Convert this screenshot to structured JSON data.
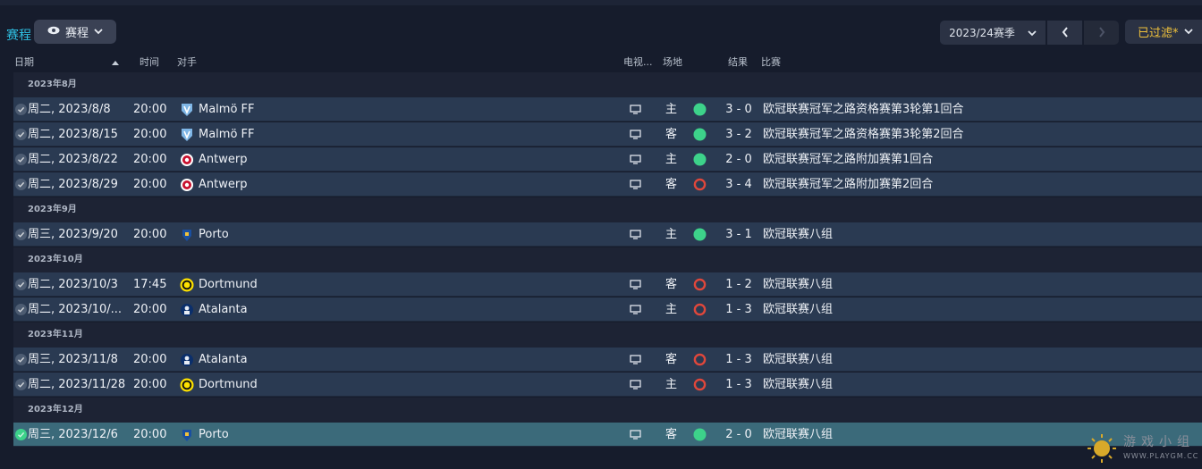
{
  "header": {
    "title": "赛程",
    "view_label": "赛程",
    "season_label": "2023/24赛季",
    "filter_label": "已过滤*"
  },
  "columns": {
    "date": "日期",
    "time": "时间",
    "opponent": "对手",
    "tv": "电视...",
    "venue": "场地",
    "result": "结果",
    "competition": "比赛"
  },
  "colors": {
    "accent": "#2fc0e3",
    "filter": "#f0c23b",
    "win": "#3dd28a",
    "loss": "#e0473b",
    "row": "#2a3a52",
    "selected_row": "#3b6a7a"
  },
  "months": [
    "2023年8月",
    "2023年9月",
    "2023年10月",
    "2023年11月",
    "2023年12月"
  ],
  "matches": [
    {
      "date": "周二, 2023/8/8",
      "time": "20:00",
      "opponent": "Malmö FF",
      "badge": "malmo-badge-icon",
      "venue": "主",
      "result": "win",
      "score": "3 - 0",
      "competition": "欧冠联赛冠军之路资格赛第3轮第1回合"
    },
    {
      "date": "周二, 2023/8/15",
      "time": "20:00",
      "opponent": "Malmö FF",
      "badge": "malmo-badge-icon",
      "venue": "客",
      "result": "win",
      "score": "3 - 2",
      "competition": "欧冠联赛冠军之路资格赛第3轮第2回合"
    },
    {
      "date": "周二, 2023/8/22",
      "time": "20:00",
      "opponent": "Antwerp",
      "badge": "antwerp-badge-icon",
      "venue": "主",
      "result": "win",
      "score": "2 - 0",
      "competition": "欧冠联赛冠军之路附加赛第1回合"
    },
    {
      "date": "周二, 2023/8/29",
      "time": "20:00",
      "opponent": "Antwerp",
      "badge": "antwerp-badge-icon",
      "venue": "客",
      "result": "loss",
      "score": "3 - 4",
      "competition": "欧冠联赛冠军之路附加赛第2回合"
    },
    {
      "date": "周三, 2023/9/20",
      "time": "20:00",
      "opponent": "Porto",
      "badge": "porto-badge-icon",
      "venue": "主",
      "result": "win",
      "score": "3 - 1",
      "competition": "欧冠联赛八组"
    },
    {
      "date": "周二, 2023/10/3",
      "time": "17:45",
      "opponent": "Dortmund",
      "badge": "dortmund-badge-icon",
      "venue": "客",
      "result": "loss",
      "score": "1 - 2",
      "competition": "欧冠联赛八组"
    },
    {
      "date": "周二, 2023/10/...",
      "time": "20:00",
      "opponent": "Atalanta",
      "badge": "atalanta-badge-icon",
      "venue": "主",
      "result": "loss",
      "score": "1 - 3",
      "competition": "欧冠联赛八组"
    },
    {
      "date": "周三, 2023/11/8",
      "time": "20:00",
      "opponent": "Atalanta",
      "badge": "atalanta-badge-icon",
      "venue": "客",
      "result": "loss",
      "score": "1 - 3",
      "competition": "欧冠联赛八组"
    },
    {
      "date": "周二, 2023/11/28",
      "time": "20:00",
      "opponent": "Dortmund",
      "badge": "dortmund-badge-icon",
      "venue": "主",
      "result": "loss",
      "score": "1 - 3",
      "competition": "欧冠联赛八组"
    },
    {
      "date": "周三, 2023/12/6",
      "time": "20:00",
      "opponent": "Porto",
      "badge": "porto-badge-icon",
      "venue": "客",
      "result": "win",
      "score": "2 - 0",
      "competition": "欧冠联赛八组"
    }
  ],
  "watermark": {
    "text": "游戏小组",
    "url": "WWW.PLAYGM.CC"
  }
}
